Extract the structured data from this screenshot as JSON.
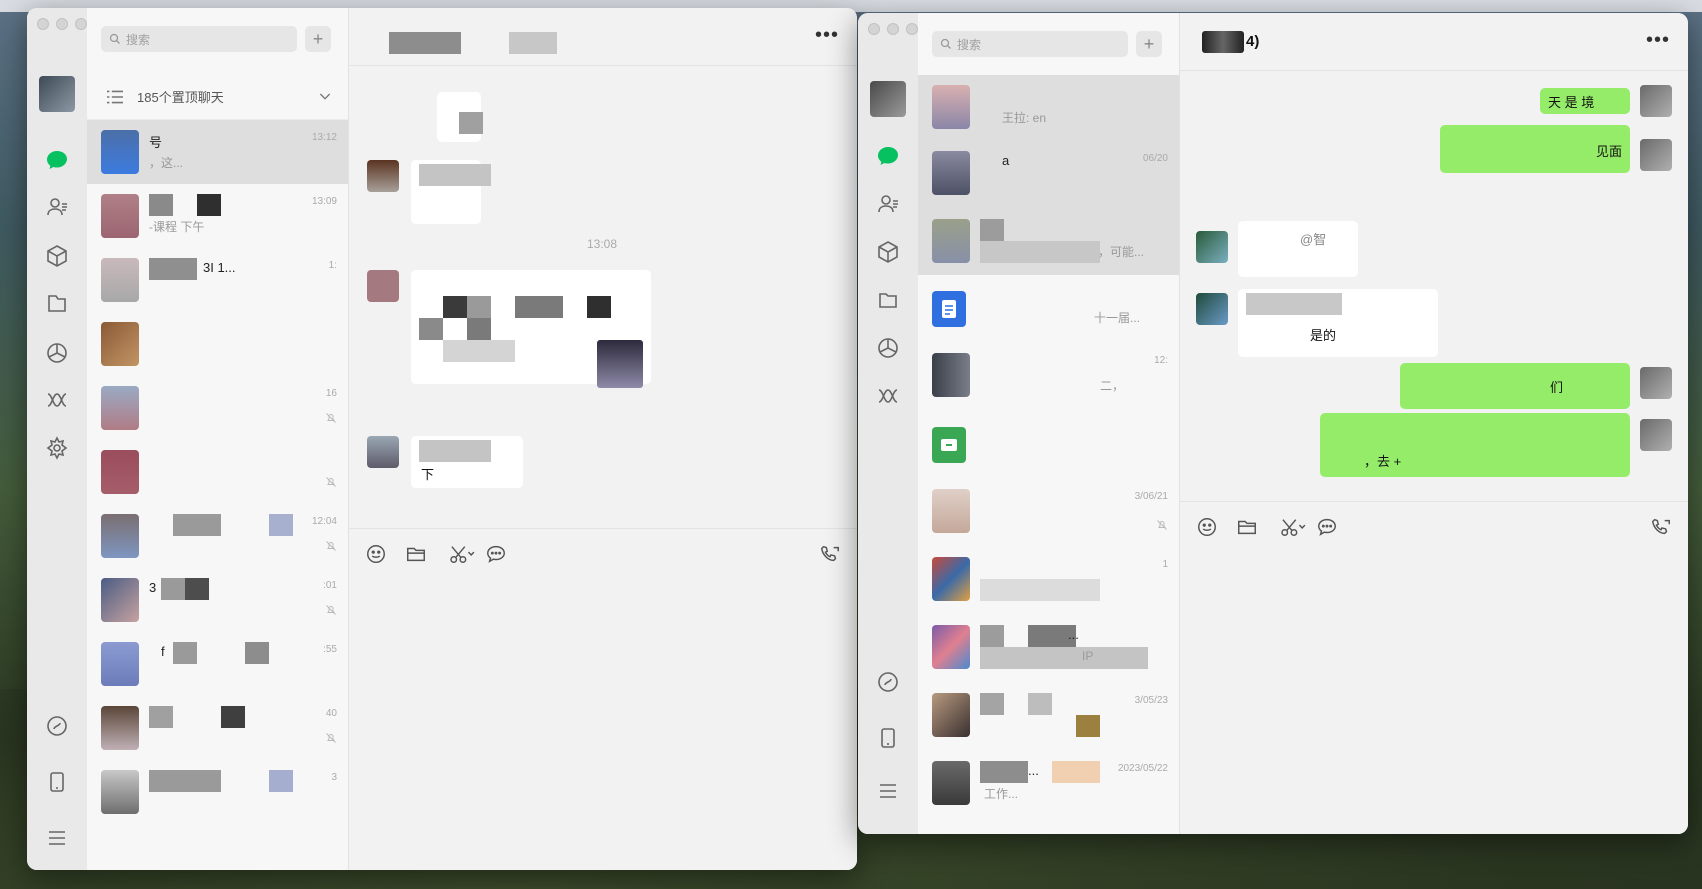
{
  "colors": {
    "accent_green": "#07c160",
    "bubble_out": "#95ec69",
    "bubble_in": "#ffffff"
  },
  "left_window": {
    "search_placeholder": "搜索",
    "add_label": "+",
    "pinned_bar": {
      "label": "185个置顶聊天",
      "icon": "list-icon"
    },
    "chats": [
      {
        "name": "号",
        "preview": "，这...",
        "time": "13:12"
      },
      {
        "name": "",
        "preview": "-课程  下午",
        "time": "13:09"
      },
      {
        "name": "3I  1...",
        "preview": "",
        "time": "1:"
      },
      {
        "name": "",
        "preview": "",
        "time": ""
      },
      {
        "name": "",
        "preview": "",
        "time": "16",
        "muted": true
      },
      {
        "name": "",
        "preview": "",
        "time": "",
        "muted": true
      },
      {
        "name": "",
        "preview": "",
        "time": "12:04",
        "muted": true
      },
      {
        "name": "3",
        "preview": "",
        "time": ":01",
        "muted": true
      },
      {
        "name": "f",
        "preview": "",
        "time": ":55"
      },
      {
        "name": "",
        "preview": "",
        "time": "40",
        "muted": true
      },
      {
        "name": "",
        "preview": "",
        "time": "3"
      }
    ],
    "conversation": {
      "title": "",
      "time_divider": "13:08",
      "message_texts": [
        "下"
      ]
    }
  },
  "right_window": {
    "search_placeholder": "搜索",
    "add_label": "+",
    "conversation_title": "4)",
    "chats": [
      {
        "name": "",
        "preview": "王拉: en",
        "time": ""
      },
      {
        "name": "a",
        "preview": "",
        "time": "06/20"
      },
      {
        "name": "",
        "preview": "，可能...",
        "time": ""
      },
      {
        "name": "",
        "preview": "十一届...",
        "time": ""
      },
      {
        "name": "",
        "preview": "二，",
        "time": "12:"
      },
      {
        "name": "",
        "preview": "",
        "time": ""
      },
      {
        "name": "",
        "preview": "",
        "time": "3/06/21",
        "muted": true
      },
      {
        "name": "",
        "preview": "",
        "time": "1"
      },
      {
        "name": "...",
        "preview": "IP",
        "time": ""
      },
      {
        "name": "",
        "preview": "",
        "time": "3/05/23"
      },
      {
        "name": "...",
        "preview": "工作...",
        "time": "2023/05/22"
      }
    ],
    "messages": [
      {
        "side": "out",
        "text": "天  是   境"
      },
      {
        "side": "out",
        "text": "见面"
      },
      {
        "side": "in",
        "text": "@智"
      },
      {
        "side": "in",
        "text": "是的"
      },
      {
        "side": "out",
        "text": "们"
      },
      {
        "side": "out",
        "text": "，去    +"
      }
    ]
  },
  "icons": {
    "nav": [
      "chat-icon",
      "contacts-icon",
      "favorites-icon",
      "files-icon",
      "moments-icon",
      "channels-icon",
      "mini-programs-icon",
      "miniprogram-link-icon",
      "phone-icon",
      "menu-icon"
    ],
    "toolbar": [
      "emoji-icon",
      "folder-icon",
      "scissors-icon",
      "chat-bubble-icon",
      "video-call-icon"
    ]
  }
}
